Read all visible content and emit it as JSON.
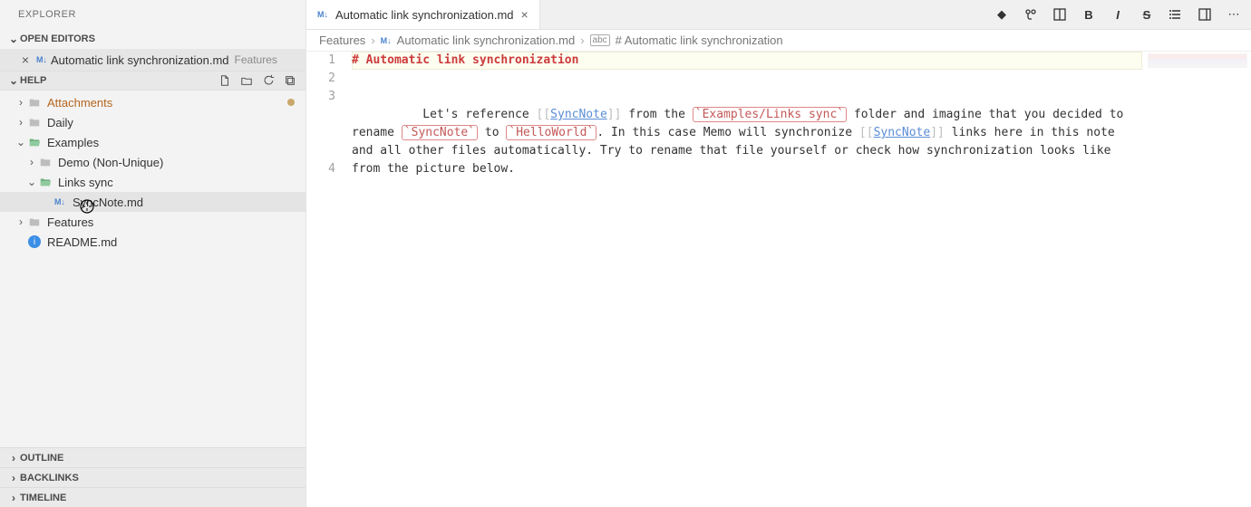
{
  "sidebar": {
    "title": "EXPLORER",
    "open_editors": {
      "label": "OPEN EDITORS",
      "items": [
        {
          "name": "Automatic link synchronization.md",
          "dir": "Features"
        }
      ]
    },
    "help": {
      "label": "HELP",
      "actions": [
        "new-file",
        "new-folder",
        "refresh",
        "collapse"
      ]
    },
    "tree": [
      {
        "depth": 0,
        "kind": "folder-closed",
        "label": "Attachments",
        "color": "attachments-color",
        "chev": "right",
        "modified": true
      },
      {
        "depth": 0,
        "kind": "folder-closed",
        "label": "Daily",
        "chev": "right"
      },
      {
        "depth": 0,
        "kind": "folder-open",
        "label": "Examples",
        "chev": "down"
      },
      {
        "depth": 1,
        "kind": "folder-closed",
        "label": "Demo (Non-Unique)",
        "chev": "right"
      },
      {
        "depth": 1,
        "kind": "folder-open",
        "label": "Links sync",
        "chev": "down"
      },
      {
        "depth": 2,
        "kind": "file-md",
        "label": "SyncNote.md",
        "selected": true
      },
      {
        "depth": 0,
        "kind": "folder-closed",
        "label": "Features",
        "chev": "right"
      },
      {
        "depth": 0,
        "kind": "file-info",
        "label": "README.md"
      }
    ],
    "bottom": [
      {
        "label": "OUTLINE"
      },
      {
        "label": "BACKLINKS"
      },
      {
        "label": "TIMELINE"
      }
    ]
  },
  "tab": {
    "title": "Automatic link synchronization.md"
  },
  "breadcrumb": {
    "seg1": "Features",
    "seg2": "Automatic link synchronization.md",
    "seg3": "# Automatic link synchronization"
  },
  "code": {
    "gutter": [
      "1",
      "2",
      "3",
      "",
      "",
      "",
      "4"
    ],
    "line1_header": "# Automatic link synchronization",
    "line3": {
      "a": "Let's reference ",
      "link1": "SyncNote",
      "b": " from the ",
      "code1": "Examples/Links sync",
      "c": " folder and imagine that you decided to rename ",
      "code2": "SyncNote",
      "d": " to ",
      "code3": "HelloWorld",
      "e": ". In this case Memo will synchronize ",
      "link2": "SyncNote",
      "f": " links here in this note and all other files automatically. Try to rename that file yourself or check how synchronization looks like from the picture below."
    }
  }
}
